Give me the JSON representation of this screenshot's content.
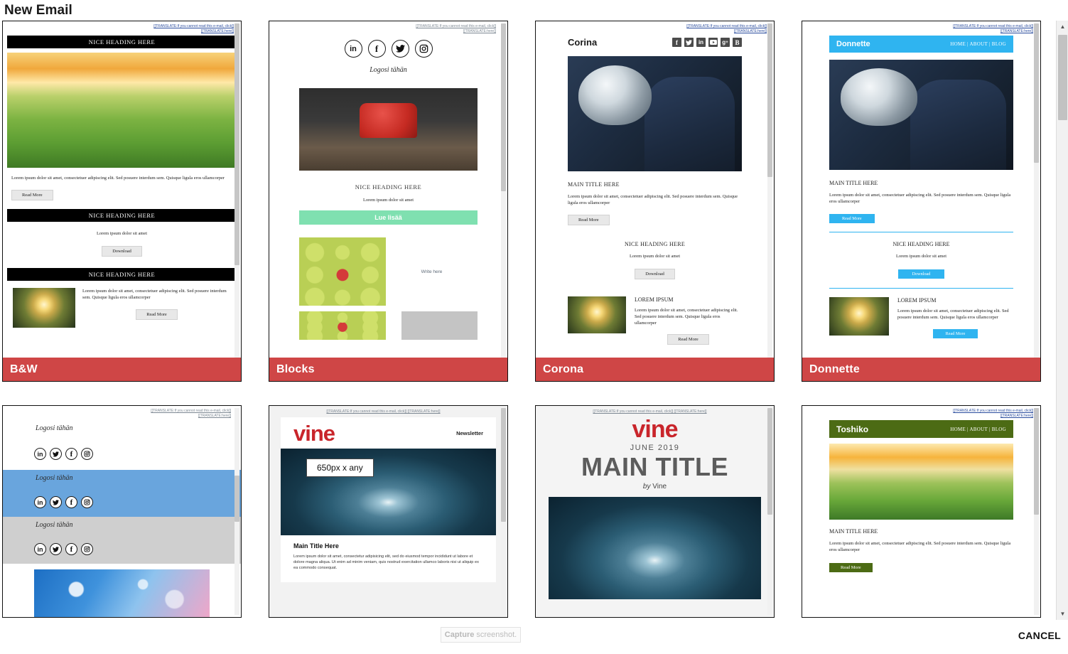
{
  "page": {
    "title": "New Email"
  },
  "common": {
    "translate_line1": "[[TRANSLATE:If you cannot read this e-mail, click]]",
    "translate_line2": "[[TRANSLATE:here]]",
    "translate_full": "[[TRANSLATE:If you cannot read this e-mail, click]] [[TRANSLATE:here]]",
    "nice_heading": "NICE HEADING HERE",
    "main_title_here": "MAIN TITLE HERE",
    "lorem_short": "Lorem ipsum dolor sit amet",
    "lorem_long": "Lorem ipsum dolor sit amet, consectetuer adipiscing elit. Sed posuere interdum sem. Quisque ligula eros ullamcorper",
    "read_more": "Read More",
    "download": "Download",
    "lorem_ipsum_caps": "LOREM IPSUM",
    "logo_placeholder": "Logosi tähän",
    "nav": "HOME  |  ABOUT  |  BLOG"
  },
  "templates": [
    {
      "id": "bw",
      "label": "B&W",
      "accent": "#000000",
      "sections": {
        "heading1": "NICE HEADING HERE",
        "body1": "Lorem ipsum dolor sit amet, consectetuer adipiscing elit. Sed posuere interdum sem. Quisque ligula eros ullamcorper",
        "btn1": "Read More",
        "heading2": "NICE HEADING HERE",
        "body2": "Lorem ipsum dolor sit amet",
        "btn2": "Download",
        "heading3": "NICE HEADING HERE",
        "body3": "Lorem ipsum dolor sit amet, consectetuer adipiscing elit. Sed posuere interdum sem. Quisque ligula eros ullamcorper",
        "btn3": "Read More"
      }
    },
    {
      "id": "blocks",
      "label": "Blocks",
      "accent": "#7fe0b0",
      "logo": "Logosi tähän",
      "social": [
        "linkedin",
        "facebook",
        "twitter",
        "instagram"
      ],
      "sections": {
        "heading1": "NICE HEADING HERE",
        "body1": "Lorem ipsum dolor sit amet",
        "cta": "Lue lisää",
        "write_here": "Write here"
      }
    },
    {
      "id": "corona",
      "label": "Corona",
      "brand": "Corina",
      "accent": "#4b4b4b",
      "social": [
        "facebook",
        "twitter",
        "linkedin",
        "youtube",
        "googleplus",
        "blogger"
      ],
      "sections": {
        "heading1": "MAIN TITLE HERE",
        "body1": "Lorem ipsum dolor sit amet, consectetuer adipiscing elit. Sed posuere interdum sem. Quisque ligula eros ullamcorper",
        "btn1": "Read More",
        "heading2": "NICE HEADING HERE",
        "body2": "Lorem ipsum dolor sit amet",
        "btn2": "Download",
        "heading3": "LOREM IPSUM",
        "body3": "Lorem ipsum dolor sit amet, consectetuer adipiscing elit. Sed posuere interdum sem. Quisque ligula eros ullamcorper",
        "btn3": "Read More"
      }
    },
    {
      "id": "donnette",
      "label": "Donnette",
      "brand": "Donnette",
      "accent": "#2fb4f0",
      "nav": "HOME  |  ABOUT  |  BLOG",
      "sections": {
        "heading1": "MAIN TITLE HERE",
        "body1": "Lorem ipsum dolor sit amet, consectetuer adipiscing elit. Sed posuere interdum sem. Quisque ligula eros ullamcorper",
        "btn1": "Read More",
        "heading2": "NICE HEADING HERE",
        "body2": "Lorem ipsum dolor sit amet",
        "btn2": "Download",
        "heading3": "LOREM IPSUM",
        "body3": "Lorem ipsum dolor sit amet, consectetuer adipiscing elit. Sed posuere interdum sem. Quisque ligula eros ullamcorper",
        "btn3": "Read More"
      }
    },
    {
      "id": "logos",
      "label": "",
      "accent": "#69a5dd",
      "logo": "Logosi tähän",
      "social": [
        "linkedin",
        "twitter",
        "facebook",
        "instagram"
      ]
    },
    {
      "id": "vine-newsletter",
      "label": "",
      "brand": "vine",
      "accent": "#c9252b",
      "tagline": "Newsletter",
      "sections": {
        "image_note": "650px x any",
        "heading1": "Main Title Here",
        "body1": "Lorem ipsum dolor sit amet, consectetur adipisicing elit, sed do eiusmod tempor incididunt ut labore et dolore magna aliqua. Ut enim ad minim veniam, quis nostrud exercitation ullamco laboris nisi ut aliquip ex ea commodo consequat."
      }
    },
    {
      "id": "vine-main",
      "label": "",
      "brand": "vine",
      "accent": "#c9252b",
      "sections": {
        "date": "JUNE 2019",
        "main_title": "MAIN TITLE",
        "byline_prefix": "by",
        "byline_name": "Vine"
      }
    },
    {
      "id": "toshiko",
      "label": "",
      "brand": "Toshiko",
      "accent": "#4c6b14",
      "nav": "HOME  |  ABOUT  |  BLOG",
      "sections": {
        "heading1": "MAIN TITLE HERE",
        "body1": "Lorem ipsum dolor sit amet, consectetuer adipiscing elit. Sed posuere interdum sem. Quisque ligula eros ullamcorper",
        "btn1": "Read More"
      }
    }
  ],
  "footer": {
    "capture_bold": "Capture",
    "capture_rest": "screenshot.",
    "cancel": "CANCEL"
  },
  "scrollbar": {
    "up_arrow": "▲",
    "down_arrow": "▼"
  }
}
